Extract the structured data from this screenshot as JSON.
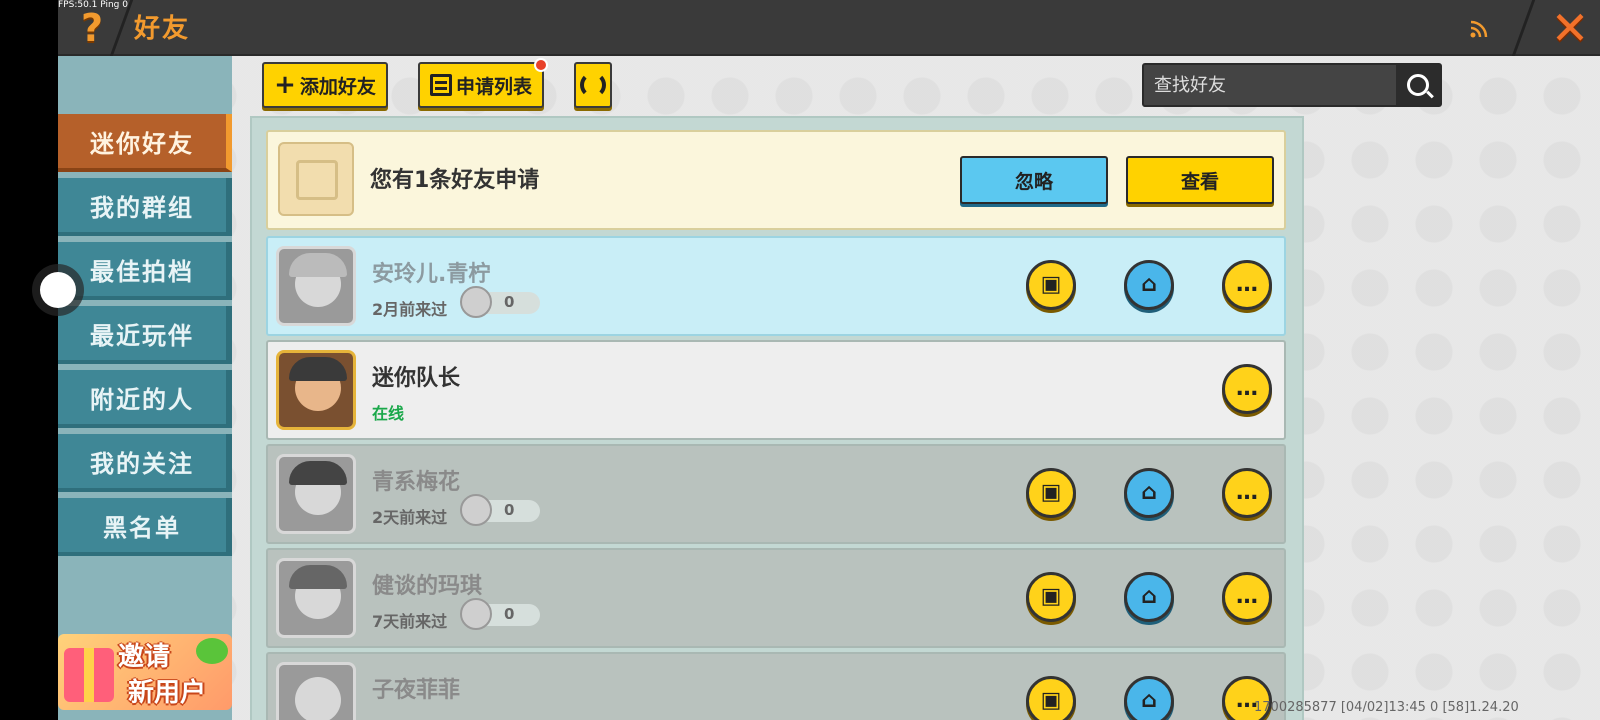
{
  "fps_text": "FPS:50.1  Ping 0",
  "header": {
    "help_glyph": "?",
    "title": "好友",
    "close_glyph": "✕"
  },
  "sidebar": {
    "items": [
      {
        "label": "迷你好友",
        "active": true
      },
      {
        "label": "我的群组",
        "active": false
      },
      {
        "label": "最佳拍档",
        "active": false
      },
      {
        "label": "最近玩伴",
        "active": false
      },
      {
        "label": "附近的人",
        "active": false
      },
      {
        "label": "我的关注",
        "active": false
      },
      {
        "label": "黑名单",
        "active": false
      }
    ],
    "invite": {
      "line1": "邀请",
      "line2": "新用户"
    }
  },
  "toolbar": {
    "add_friend_label": "添加好友",
    "request_list_label": "申请列表",
    "search_placeholder": "查找好友"
  },
  "request": {
    "text": "您有1条好友申请",
    "ignore_label": "忽略",
    "view_label": "查看"
  },
  "friends": [
    {
      "name": "安玲儿.青柠",
      "status": "2月前来过",
      "score": "0",
      "state": "highlight",
      "buttons": [
        "gift",
        "home",
        "chat"
      ]
    },
    {
      "name": "迷你队长",
      "status": "在线",
      "score": null,
      "state": "online",
      "buttons": [
        "chat"
      ]
    },
    {
      "name": "青系梅花",
      "status": "2天前来过",
      "score": "0",
      "state": "offline",
      "buttons": [
        "gift",
        "home",
        "chat"
      ]
    },
    {
      "name": "健谈的玛琪",
      "status": "7天前来过",
      "score": "0",
      "state": "offline",
      "buttons": [
        "gift",
        "home",
        "chat"
      ]
    },
    {
      "name": "子夜菲菲",
      "status": "",
      "score": "",
      "state": "offline",
      "buttons": [
        "gift",
        "home",
        "chat"
      ]
    }
  ],
  "footer": {
    "text": "1700285877    [04/02]13:45 0  [58]1.24.20"
  },
  "colors": {
    "accent_orange": "#f29a2e",
    "button_yellow": "#ffd200",
    "button_blue": "#5bc8f0",
    "sidebar_teal": "#3f8796",
    "online_green": "#1aa84a"
  }
}
